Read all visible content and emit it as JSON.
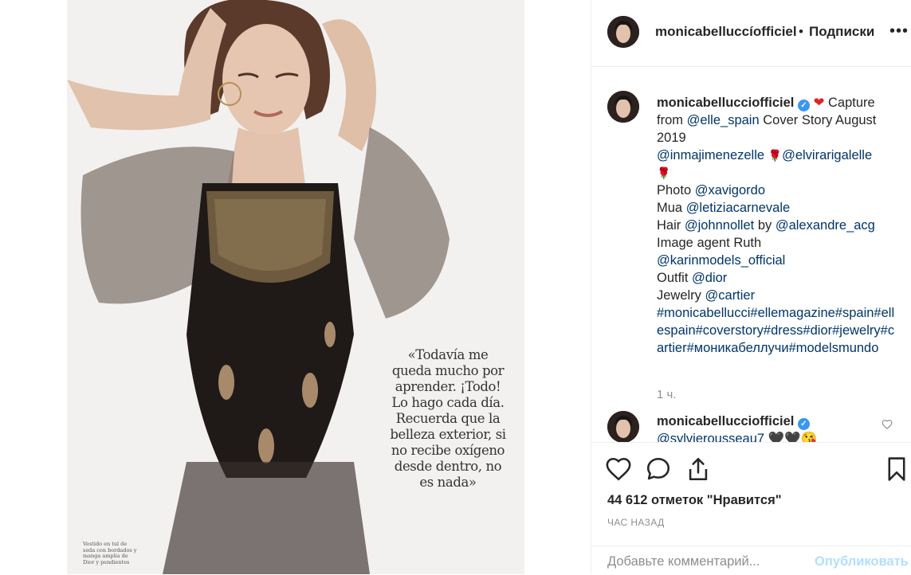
{
  "photo": {
    "quote": "«Todavía me queda mucho por aprender. ¡Todo! Lo hago cada día. Recuerda que la belleza exterior, si no recibe oxígeno desde dentro, no es nada»",
    "caption": "Vestido en tul de seda con bordados y manga amplia de Dior y pendientes"
  },
  "header": {
    "username": "monicabelluccíofficiel",
    "dot": "•",
    "follow_label": "Подписки",
    "more_icon": "more-icon"
  },
  "caption": {
    "username": "monicabellucciofficiel",
    "line1_text": " Capture from ",
    "mention_elle": "@elle_spain",
    "line1_tail": " Cover Story August 2019",
    "mention_inma": "@inmajimenezelle",
    "mention_elvira": "@elvirarigalelle",
    "photo_label": "Photo ",
    "mention_photo": "@xavigordo",
    "mua_label": "Mua ",
    "mention_mua": "@letiziacarnevale",
    "hair_label": "Hair ",
    "mention_hair": "@johnnollet",
    "by_label": " by ",
    "mention_hair2": "@alexandre_acg",
    "agent_label": "Image agent Ruth ",
    "mention_agent": "@karinmodels_official",
    "outfit_label": "Outfit ",
    "mention_outfit": "@dior",
    "jewelry_label": "Jewelry ",
    "mention_jewelry": "@cartier",
    "hashtags": "#monicabellucci#ellemagazine#spain#ellespain#coverstory#dress#dior#jewelry#cartier#моникабеллучи#modelsmundo",
    "time": "1 ч."
  },
  "comment2": {
    "username": "monicabellucciofficiel",
    "mention": "@sylvierousseau7",
    "emoji": " 🖤🖤😘"
  },
  "actions": {
    "like_count": "44 612 отметок \"Нравится\"",
    "post_time": "ЧАС НАЗАД"
  },
  "add_comment": {
    "placeholder": "Добавьте комментарий...",
    "publish_label": "Опубликовать"
  },
  "colors": {
    "link": "#003569",
    "verified": "#3897f0",
    "muted": "#8e8e8e",
    "publish": "#b2dffc"
  }
}
